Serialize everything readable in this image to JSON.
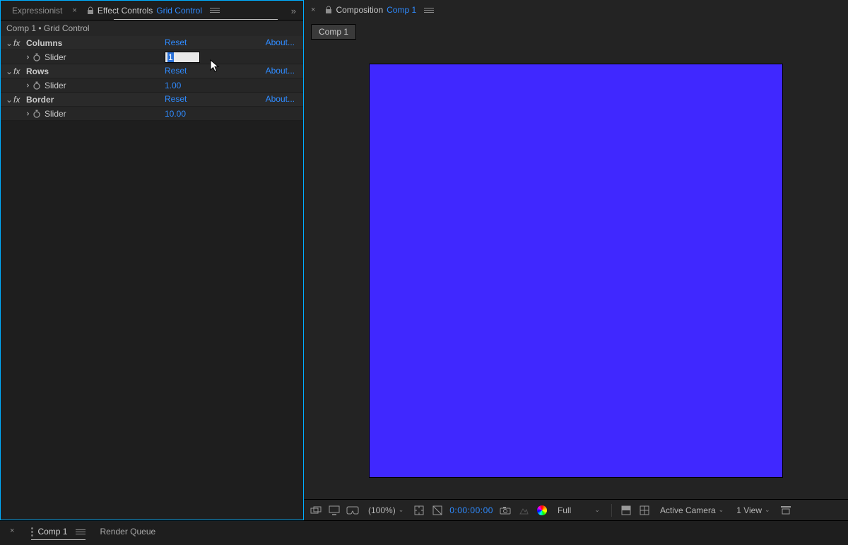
{
  "leftPanel": {
    "tabs": {
      "expressionist": "Expressionist",
      "effectControls": "Effect Controls",
      "layerName": "Grid Control"
    },
    "breadcrumb": "Comp 1 • Grid Control",
    "effects": [
      {
        "name": "Columns",
        "reset": "Reset",
        "about": "About...",
        "slider": {
          "label": "Slider",
          "value": "1",
          "editing": true
        }
      },
      {
        "name": "Rows",
        "reset": "Reset",
        "about": "About...",
        "slider": {
          "label": "Slider",
          "value": "1.00",
          "editing": false
        }
      },
      {
        "name": "Border",
        "reset": "Reset",
        "about": "About...",
        "slider": {
          "label": "Slider",
          "value": "10.00",
          "editing": false
        }
      }
    ]
  },
  "rightPanel": {
    "tabTitle": "Composition",
    "compName": "Comp 1",
    "flowTab": "Comp 1",
    "toolbar": {
      "zoom": "(100%)",
      "timecode": "0:00:00:00",
      "resolution": "Full",
      "camera": "Active Camera",
      "views": "1 View"
    }
  },
  "bottomBar": {
    "comp": "Comp 1",
    "renderQueue": "Render Queue"
  },
  "colors": {
    "canvas": "#4028ff"
  }
}
